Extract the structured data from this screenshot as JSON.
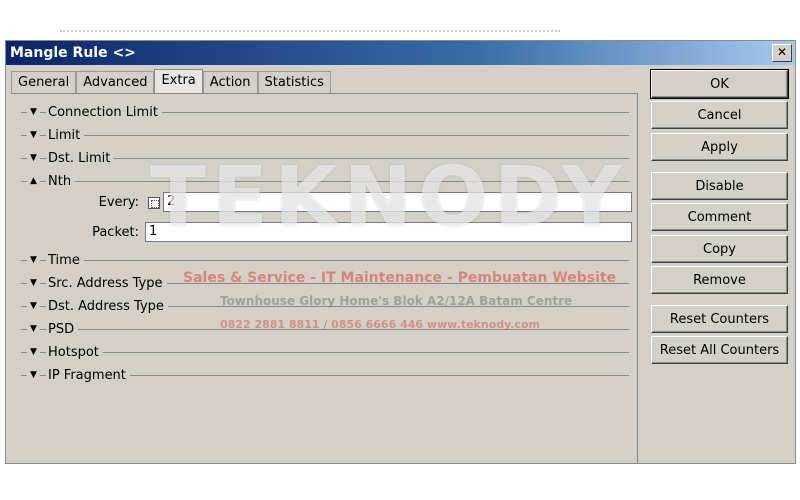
{
  "window": {
    "title": "Mangle Rule <>",
    "close_glyph": "✕"
  },
  "tabs": [
    {
      "label": "General"
    },
    {
      "label": "Advanced"
    },
    {
      "label": "Extra",
      "active": true
    },
    {
      "label": "Action"
    },
    {
      "label": "Statistics"
    }
  ],
  "sections": [
    {
      "label": "Connection Limit",
      "expanded": false
    },
    {
      "label": "Limit",
      "expanded": false
    },
    {
      "label": "Dst. Limit",
      "expanded": false
    },
    {
      "label": "Nth",
      "expanded": true
    },
    {
      "label": "Time",
      "expanded": false
    },
    {
      "label": "Src. Address Type",
      "expanded": false
    },
    {
      "label": "Dst. Address Type",
      "expanded": false
    },
    {
      "label": "PSD",
      "expanded": false
    },
    {
      "label": "Hotspot",
      "expanded": false
    },
    {
      "label": "IP Fragment",
      "expanded": false
    }
  ],
  "nth": {
    "every_label": "Every:",
    "every_value": "2",
    "packet_label": "Packet:",
    "packet_value": "1"
  },
  "buttons": {
    "ok": "OK",
    "cancel": "Cancel",
    "apply": "Apply",
    "disable": "Disable",
    "comment": "Comment",
    "copy": "Copy",
    "remove": "Remove",
    "reset_counters": "Reset Counters",
    "reset_all_counters": "Reset All Counters"
  },
  "watermark": {
    "brand": "TEKNODY",
    "line1": "Sales & Service - IT Maintenance - Pembuatan Website",
    "line2": "Townhouse Glory Home's Blok A2/12A Batam Centre",
    "line3": "0822 2881 8811 / 0856 6666 446   www.teknody.com"
  },
  "icons": {
    "collapsed": "▼",
    "expanded": "▲"
  }
}
